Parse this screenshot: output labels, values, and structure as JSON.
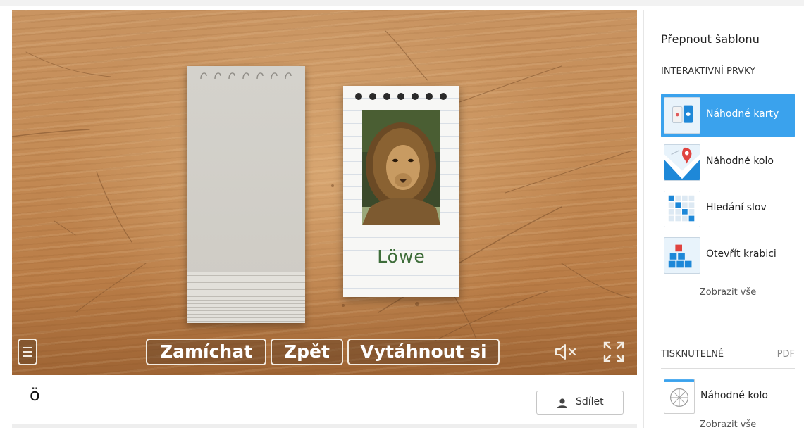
{
  "stage": {
    "card_word": "Löwe",
    "card_image": "lion-photo",
    "controls": {
      "shuffle": "Zamíchat",
      "back": "Zpět",
      "draw": "Vytáhnout si"
    },
    "icons": {
      "menu": "menu-icon",
      "sound": "mute-icon",
      "fullscreen": "fullscreen-icon"
    }
  },
  "activity": {
    "title": "ö",
    "share_label": "Sdílet"
  },
  "sidebar": {
    "title": "Přepnout šablonu",
    "interactive_heading": "INTERAKTIVNÍ PRVKY",
    "interactive_items": [
      {
        "label": "Náhodné karty",
        "icon": "random-cards-icon",
        "active": true
      },
      {
        "label": "Náhodné kolo",
        "icon": "random-wheel-icon",
        "active": false
      },
      {
        "label": "Hledání slov",
        "icon": "word-search-icon",
        "active": false
      },
      {
        "label": "Otevřít krabici",
        "icon": "open-box-icon",
        "active": false
      }
    ],
    "show_all": "Zobrazit vše",
    "printable_heading": "TISKNUTELNÉ",
    "printable_format": "PDF",
    "printable_items": [
      {
        "label": "Náhodné kolo",
        "icon": "random-wheel-print-icon"
      }
    ],
    "printable_show_all": "Zobrazit vše"
  },
  "colors": {
    "accent": "#3aa2ed",
    "card_word": "#3e6d3a"
  }
}
